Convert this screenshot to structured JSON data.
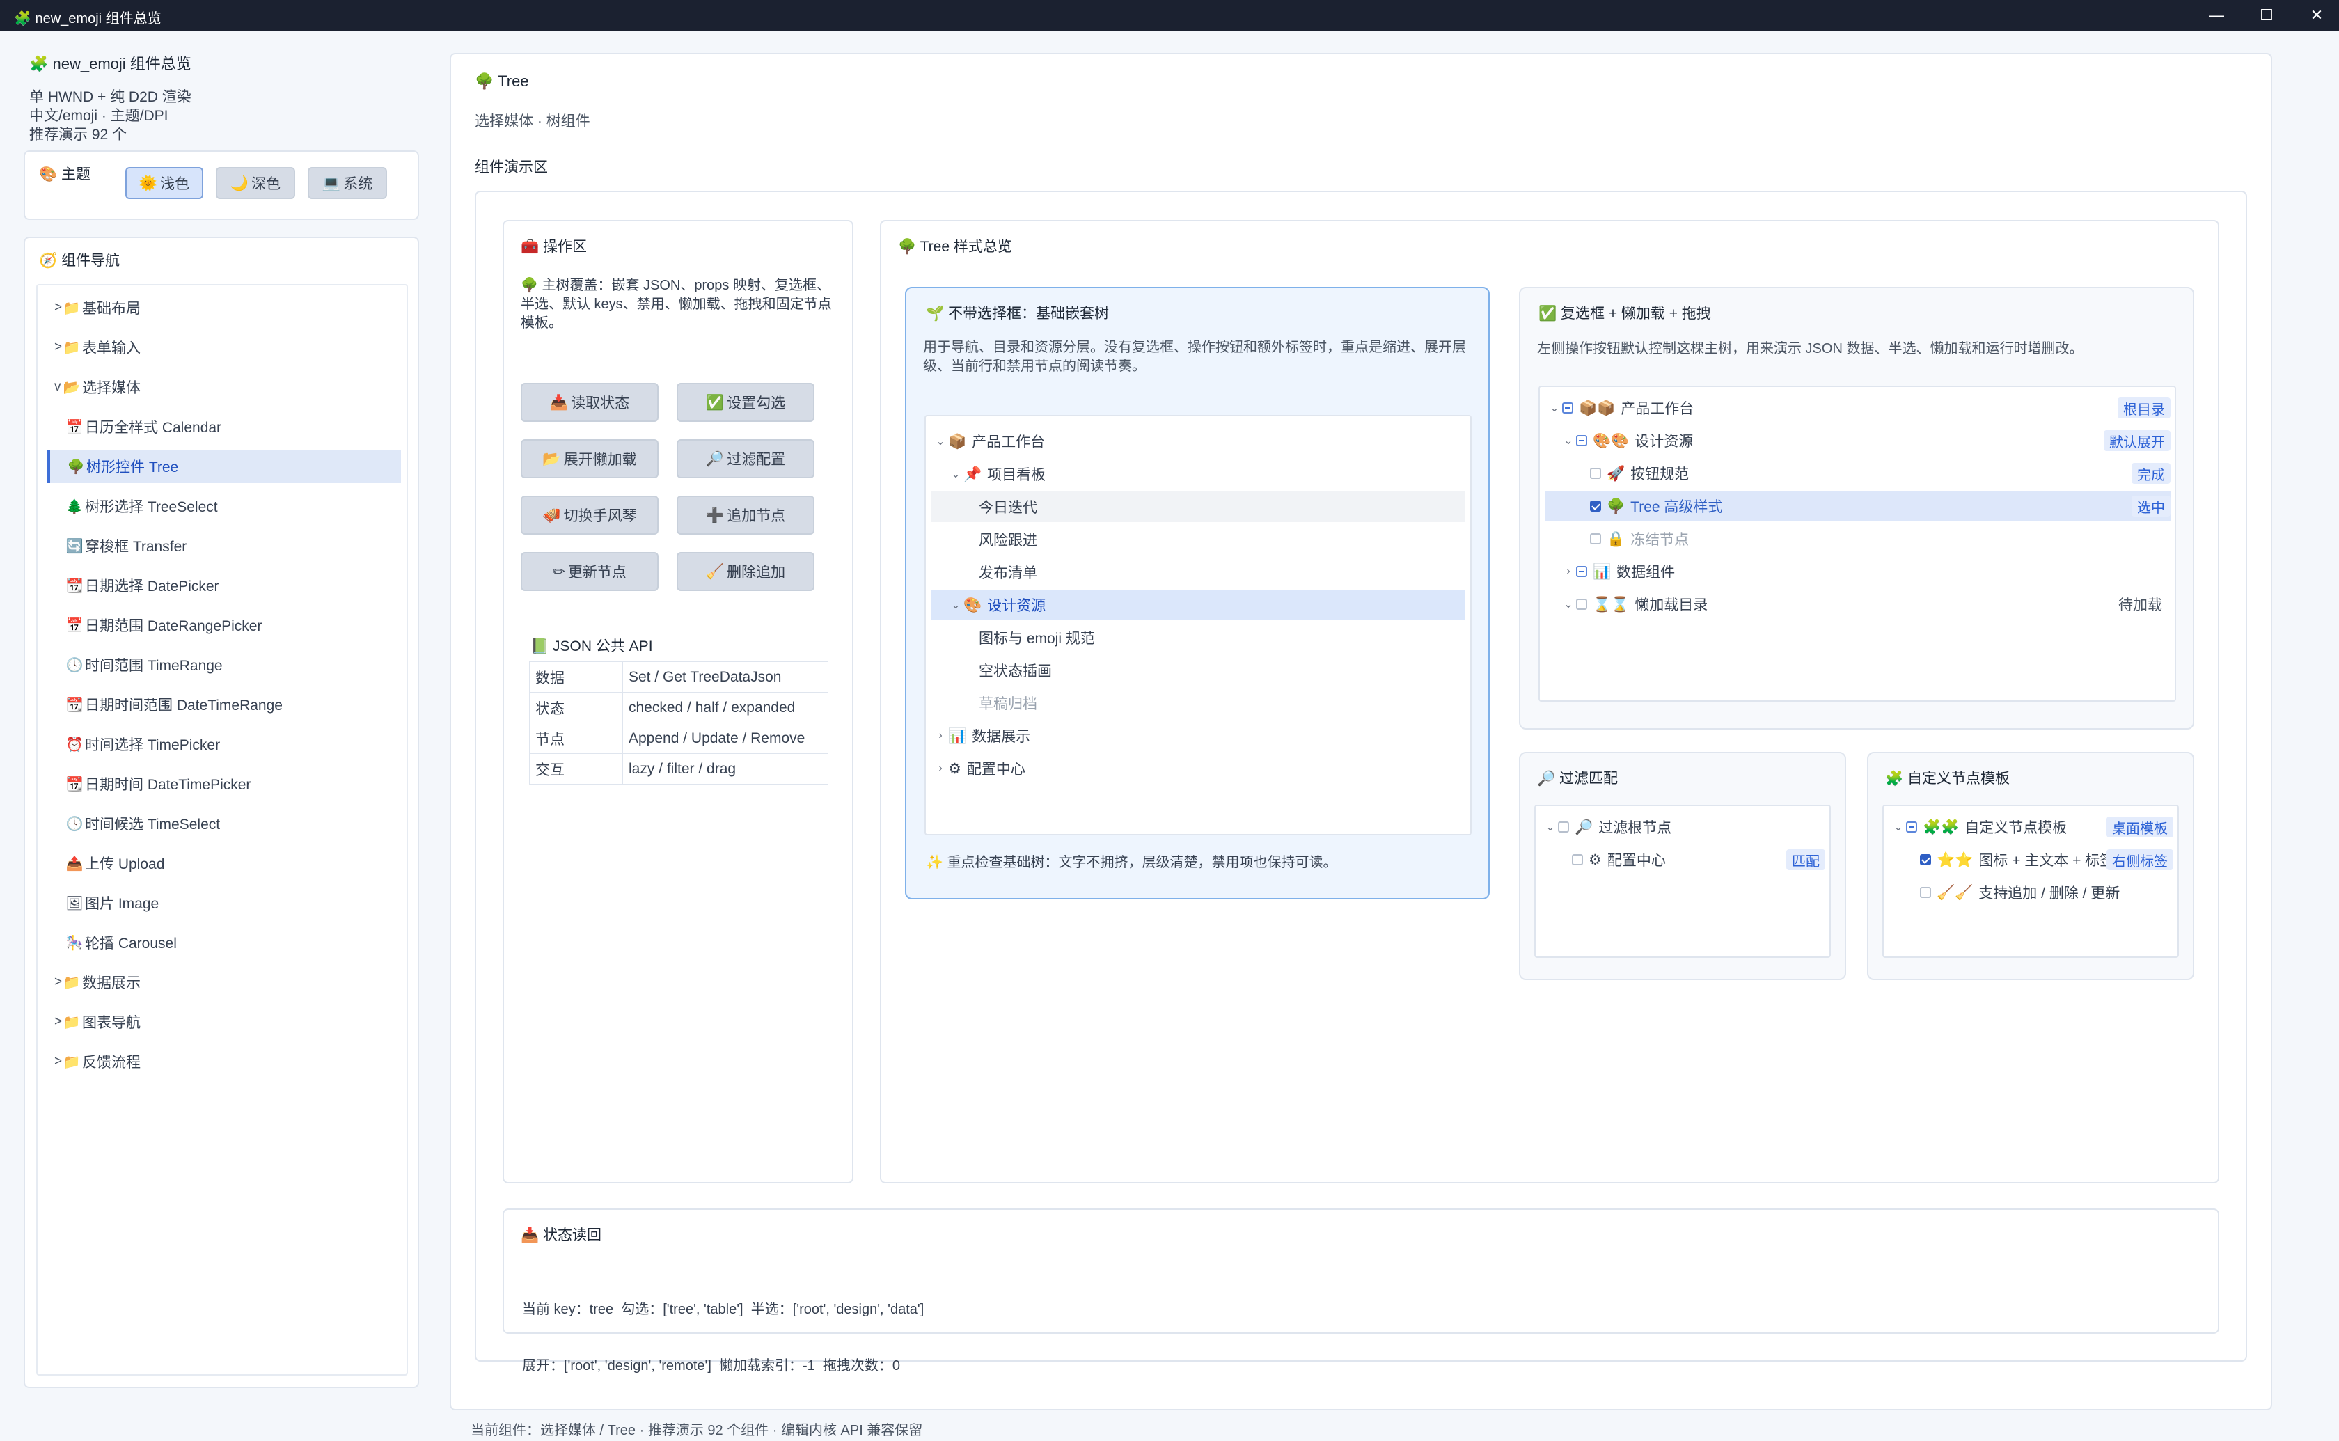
{
  "window": {
    "title": "new_emoji 组件总览",
    "icon": "puzzle-icon"
  },
  "sidebar": {
    "app_title": "new_emoji 组件总览",
    "info_lines": [
      "单 HWND + 纯 D2D 渲染",
      "中文/emoji · 主题/DPI",
      "推荐演示 92 个"
    ],
    "theme": {
      "label": "主题",
      "buttons": [
        {
          "emoji": "🌞",
          "label": "浅色",
          "active": true
        },
        {
          "emoji": "🌙",
          "label": "深色",
          "active": false
        },
        {
          "emoji": "💻",
          "label": "系统",
          "active": false
        }
      ]
    },
    "nav_title": "组件导航",
    "nav_items": [
      {
        "prefix": ">",
        "emoji": "📁",
        "label": "基础布局"
      },
      {
        "prefix": ">",
        "emoji": "📁",
        "label": "表单输入"
      },
      {
        "prefix": "v",
        "emoji": "📂",
        "label": "选择媒体"
      },
      {
        "emoji": "📅",
        "label": "日历全样式 Calendar"
      },
      {
        "emoji": "🌳",
        "label": "树形控件 Tree",
        "selected": true
      },
      {
        "emoji": "🌲",
        "label": "树形选择 TreeSelect"
      },
      {
        "emoji": "🔄",
        "label": "穿梭框 Transfer"
      },
      {
        "emoji": "📆",
        "label": "日期选择 DatePicker"
      },
      {
        "emoji": "📅",
        "label": "日期范围 DateRangePicker"
      },
      {
        "emoji": "🕓",
        "label": "时间范围 TimeRange"
      },
      {
        "emoji": "📆",
        "label": "日期时间范围 DateTimeRange"
      },
      {
        "emoji": "⏰",
        "label": "时间选择 TimePicker"
      },
      {
        "emoji": "📆",
        "label": "日期时间 DateTimePicker"
      },
      {
        "emoji": "🕓",
        "label": "时间候选 TimeSelect"
      },
      {
        "emoji": "📤",
        "label": "上传 Upload"
      },
      {
        "emoji": "🖼",
        "label": "图片 Image"
      },
      {
        "emoji": "🎠",
        "label": "轮播 Carousel"
      },
      {
        "prefix": ">",
        "emoji": "📁",
        "label": "数据展示"
      },
      {
        "prefix": ">",
        "emoji": "📁",
        "label": "图表导航"
      },
      {
        "prefix": ">",
        "emoji": "📁",
        "label": "反馈流程"
      }
    ]
  },
  "main": {
    "title": "Tree",
    "subtitle": "选择媒体 · 树组件",
    "demo_area_label": "组件演示区",
    "ops": {
      "title": "操作区",
      "desc": "主树覆盖：嵌套 JSON、props 映射、复选框、半选、默认 keys、禁用、懒加载、拖拽和固定节点模板。",
      "buttons": [
        {
          "emoji": "📥",
          "label": "读取状态"
        },
        {
          "emoji": "✅",
          "label": "设置勾选"
        },
        {
          "emoji": "📂",
          "label": "展开懒加载"
        },
        {
          "emoji": "🔎",
          "label": "过滤配置"
        },
        {
          "emoji": "🪗",
          "label": "切换手风琴"
        },
        {
          "emoji": "➕",
          "label": "追加节点"
        },
        {
          "emoji": "✏",
          "label": "更新节点"
        },
        {
          "emoji": "🧹",
          "label": "删除追加"
        }
      ],
      "api_title": "JSON 公共 API",
      "api_rows": [
        [
          "数据",
          "Set / Get TreeDataJson"
        ],
        [
          "状态",
          "checked / half / expanded"
        ],
        [
          "节点",
          "Append / Update / Remove"
        ],
        [
          "交互",
          "lazy / filter / drag"
        ]
      ]
    },
    "overview_title": "Tree 样式总览",
    "basic": {
      "title": "不带选择框：基础嵌套树",
      "desc": "用于导航、目录和资源分层。没有复选框、操作按钮和额外标签时，重点是缩进、展开层级、当前行和禁用节点的阅读节奏。",
      "nodes": [
        {
          "chev": "⌄",
          "emoji": "📦",
          "label": "产品工作台",
          "level": 0
        },
        {
          "chev": "⌄",
          "emoji": "📌",
          "label": "项目看板",
          "level": 1
        },
        {
          "label": "今日迭代",
          "level": 2,
          "hover": true
        },
        {
          "label": "风险跟进",
          "level": 2
        },
        {
          "label": "发布清单",
          "level": 2
        },
        {
          "chev": "⌄",
          "emoji": "🎨",
          "label": "设计资源",
          "level": 1,
          "selected": true
        },
        {
          "label": "图标与 emoji 规范",
          "level": 2
        },
        {
          "label": "空状态插画",
          "level": 2
        },
        {
          "label": "草稿归档",
          "level": 2,
          "disabled": true
        },
        {
          "chev": "›",
          "emoji": "📊",
          "label": "数据展示",
          "level": 0
        },
        {
          "chev": "›",
          "emoji": "⚙",
          "label": "配置中心",
          "level": 0
        }
      ],
      "footnote": "重点检查基础树：文字不拥挤，层级清楚，禁用项也保持可读。"
    },
    "checkbox": {
      "title": "复选框 + 懒加载 + 拖拽",
      "desc": "左侧操作按钮默认控制这棵主树，用来演示 JSON 数据、半选、懒加载和运行时增删改。",
      "nodes": [
        {
          "chev": "⌄",
          "box": "half",
          "emoji": "📦📦",
          "label": "产品工作台",
          "tag": "根目录",
          "level": 0
        },
        {
          "chev": "⌄",
          "box": "half",
          "emoji": "🎨🎨",
          "label": "设计资源",
          "tag": "默认展开",
          "level": 1
        },
        {
          "box": "off",
          "emoji": "🚀",
          "label": "按钮规范",
          "tag": "完成",
          "level": 2
        },
        {
          "box": "on",
          "emoji": "🌳",
          "label": "Tree 高级样式",
          "tag": "选中",
          "level": 2,
          "selected": true
        },
        {
          "box": "off",
          "emoji": "🔒",
          "label": "冻结节点",
          "level": 2,
          "disabled": true
        },
        {
          "chev": "›",
          "box": "half",
          "emoji": "📊",
          "label": "数据组件",
          "level": 1
        },
        {
          "chev": "⌄",
          "box": "off",
          "emoji": "⌛⌛",
          "label": "懒加载目录",
          "status": "待加载",
          "level": 1
        }
      ]
    },
    "filter": {
      "title": "过滤匹配",
      "nodes": [
        {
          "chev": "⌄",
          "box": "off",
          "emoji": "🔎",
          "label": "过滤根节点",
          "level": 0
        },
        {
          "box": "off",
          "emoji": "⚙",
          "label": "配置中心",
          "tag": "匹配",
          "level": 1
        }
      ]
    },
    "custom": {
      "title": "自定义节点模板",
      "nodes": [
        {
          "chev": "⌄",
          "box": "half",
          "emoji": "🧩🧩",
          "label": "自定义节点模板",
          "tag": "桌面模板",
          "level": 0
        },
        {
          "box": "on",
          "emoji": "⭐⭐",
          "label": "图标 + 主文本 + 标签",
          "tag": "右侧标签",
          "level": 1
        },
        {
          "box": "off",
          "emoji": "🧹🧹",
          "label": "支持追加 / 删除 / 更新",
          "level": 1
        }
      ]
    },
    "status": {
      "title": "状态读回",
      "line1": "当前 key：tree  勾选：['tree', 'table']  半选：['root', 'design', 'data']",
      "line2": "展开：['root', 'design', 'remote']  懒加载索引：-1  拖拽次数：0"
    },
    "footer": "当前组件：选择媒体 / Tree · 推荐演示 92 个组件 · 编辑内核 API 兼容保留"
  },
  "colors": {
    "accent": "#2f5fc4",
    "selected_bg": "#dfe8f8",
    "titlebar": "#1b2130"
  }
}
